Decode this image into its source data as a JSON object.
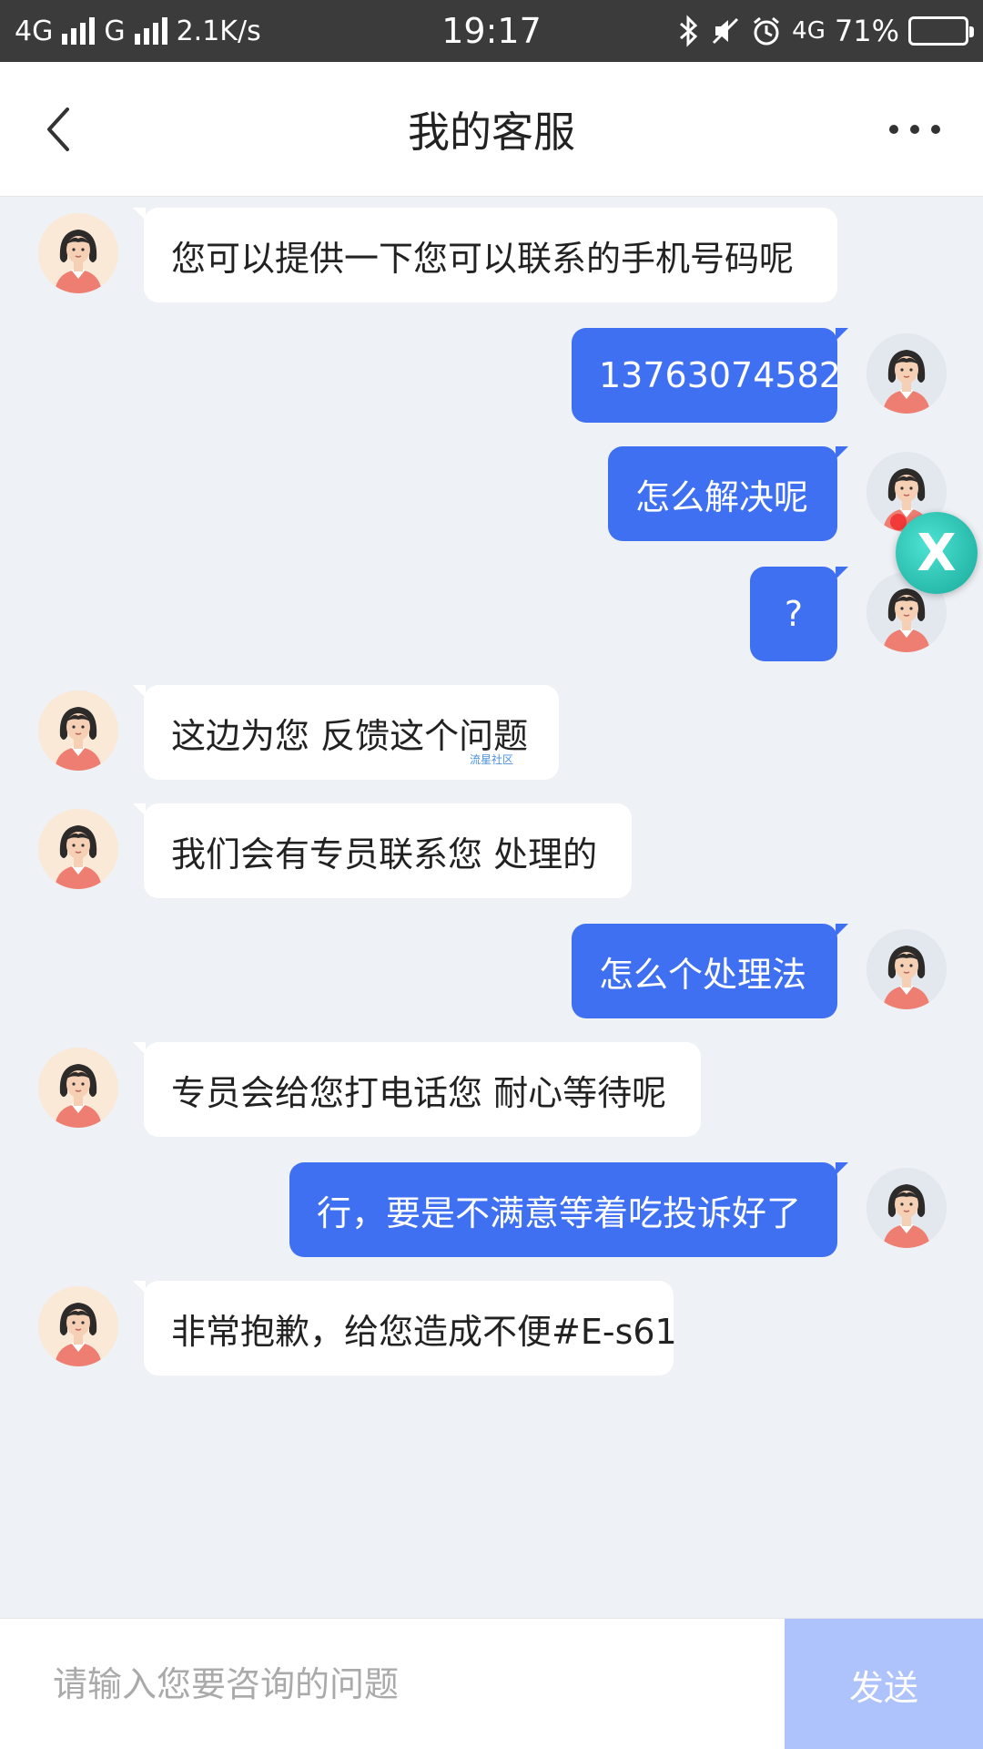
{
  "status_bar": {
    "network1": "4G",
    "network2": "G",
    "speed": "2.1K/s",
    "time": "19:17",
    "network3": "4G",
    "battery_percent": "71%",
    "battery_level": 0.71
  },
  "header": {
    "title": "我的客服"
  },
  "messages": [
    {
      "from": "agent",
      "text": "您可以提供一下您可以联系的手机号码呢"
    },
    {
      "from": "user",
      "text": "13763074582"
    },
    {
      "from": "user",
      "text": "怎么解决呢"
    },
    {
      "from": "user",
      "text": "?"
    },
    {
      "from": "agent",
      "text": "这边为您 反馈这个问题",
      "watermark": "流星社区"
    },
    {
      "from": "agent",
      "text": "我们会有专员联系您 处理的"
    },
    {
      "from": "user",
      "text": "怎么个处理法"
    },
    {
      "from": "agent",
      "text": "专员会给您打电话您 耐心等待呢"
    },
    {
      "from": "user",
      "text": "行，要是不满意等着吃投诉好了"
    },
    {
      "from": "agent",
      "text": "非常抱歉，给您造成不便#E-s61"
    }
  ],
  "overlay": {
    "close_label": "X"
  },
  "input": {
    "placeholder": "请输入您要咨询的问题",
    "value": "",
    "send_label": "发送"
  },
  "colors": {
    "user_bubble": "#3f70f1",
    "agent_bubble": "#ffffff",
    "chat_bg": "#eef1f5",
    "send_button": "#aec2fb"
  }
}
